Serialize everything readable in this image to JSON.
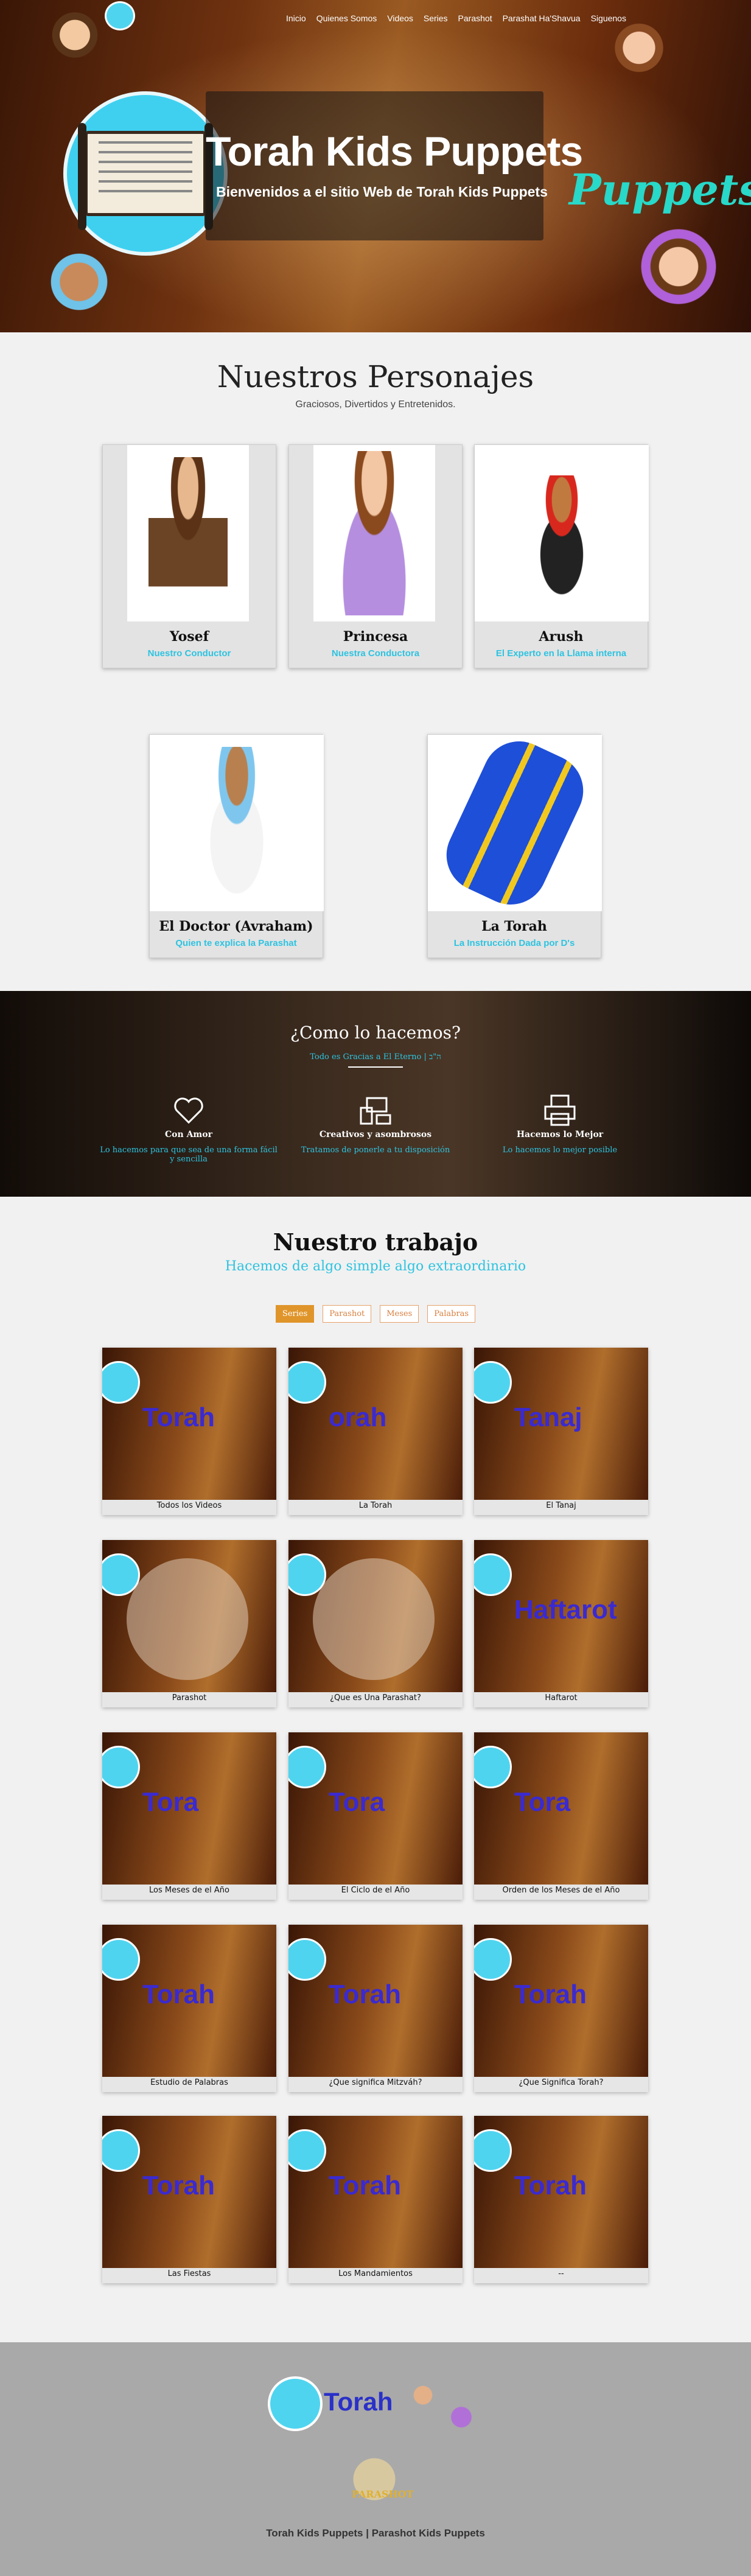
{
  "nav": {
    "items": [
      "Inicio",
      "Quienes Somos",
      "Videos",
      "Series",
      "Parashot",
      "Parashat Ha'Shavua",
      "Siguenos"
    ]
  },
  "hero": {
    "title": "Torah Kids Puppets",
    "subtitle": "Bienvenidos a el sitio Web de Torah Kids Puppets",
    "side_word": "Puppets"
  },
  "characters": {
    "title": "Nuestros Personajes",
    "subtitle": "Graciosos, Divertidos y Entretenidos.",
    "items": [
      {
        "name": "Yosef",
        "role": "Nuestro Conductor"
      },
      {
        "name": "Princesa",
        "role": "Nuestra Conductora"
      },
      {
        "name": "Arush",
        "role": "El Experto en la Llama interna"
      },
      {
        "name": "El Doctor (Avraham)",
        "role": "Quien te explica la Parashat"
      },
      {
        "name": "La Torah",
        "role": "La Instrucción Dada por D's"
      }
    ]
  },
  "how": {
    "title": "¿Como lo hacemos?",
    "subtitle": "Todo es Gracias a El Eterno | ה\"ב",
    "features": [
      {
        "icon": "heart-icon",
        "title": "Con Amor",
        "desc": "Lo hacemos para que sea de una forma fácil y sencilla"
      },
      {
        "icon": "devices-icon",
        "title": "Creativos y asombrosos",
        "desc": "Tratamos de ponerle a tu disposición"
      },
      {
        "icon": "printer-icon",
        "title": "Hacemos lo Mejor",
        "desc": "Lo hacemos lo mejor posible"
      }
    ]
  },
  "work": {
    "title": "Nuestro trabajo",
    "subtitle": "Hacemos de algo simple algo extraordinario",
    "filters": [
      "Series",
      "Parashot",
      "Meses",
      "Palabras"
    ],
    "tiles": [
      {
        "label": "Todos los Videos",
        "overlay": "Torah"
      },
      {
        "label": "La Torah",
        "overlay": "orah"
      },
      {
        "label": "El Tanaj",
        "overlay": "Tanaj"
      },
      {
        "label": "Parashot",
        "overlay": ""
      },
      {
        "label": "¿Que es Una Parashat?",
        "overlay": ""
      },
      {
        "label": "Haftarot",
        "overlay": "Haftarot"
      },
      {
        "label": "Los Meses de el Año",
        "overlay": "Tora"
      },
      {
        "label": "El Ciclo de el Año",
        "overlay": "Tora"
      },
      {
        "label": "Orden de los Meses de el Año",
        "overlay": "Tora"
      },
      {
        "label": "Estudio de Palabras",
        "overlay": "Torah"
      },
      {
        "label": "¿Que significa Mitzváh?",
        "overlay": "Torah"
      },
      {
        "label": "¿Que Significa Torah?",
        "overlay": "Torah"
      },
      {
        "label": "Las Fiestas",
        "overlay": "Torah"
      },
      {
        "label": "Los Mandamientos",
        "overlay": "Torah"
      },
      {
        "label": "--",
        "overlay": "Torah"
      }
    ]
  },
  "footer": {
    "logo_word": "Torah",
    "parashot_word": "PARASHOT",
    "title": "Torah Kids Puppets | Parashot Kids Puppets"
  },
  "colors": {
    "accent": "#2ec3e0",
    "orange": "#e0952a",
    "footer": "#a9a9a9"
  }
}
